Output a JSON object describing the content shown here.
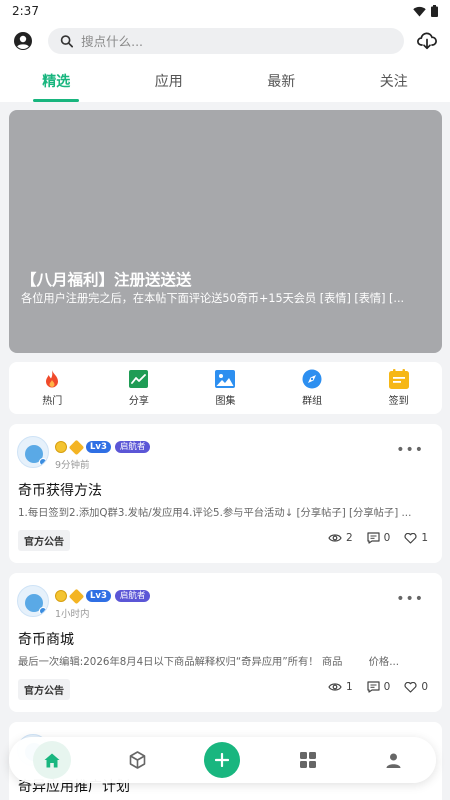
{
  "status": {
    "time": "2:37"
  },
  "search": {
    "placeholder": "搜点什么..."
  },
  "tabs": [
    {
      "label": "精选"
    },
    {
      "label": "应用"
    },
    {
      "label": "最新"
    },
    {
      "label": "关注"
    }
  ],
  "banner": {
    "title": "【八月福利】注册送送送",
    "desc": "各位用户注册完之后，在本帖下面评论送50奇币+15天会员 [表情] [表情] [..."
  },
  "quicknav": [
    {
      "label": "热门",
      "icon": "fire-icon"
    },
    {
      "label": "分享",
      "icon": "chart-icon"
    },
    {
      "label": "图集",
      "icon": "image-icon"
    },
    {
      "label": "群组",
      "icon": "compass-icon"
    },
    {
      "label": "签到",
      "icon": "checkin-icon"
    }
  ],
  "posts": [
    {
      "level": "Lv3",
      "role": "启航者",
      "time": "9分钟前",
      "title": "奇币获得方法",
      "excerpt": "1.每日签到2.添加Q群3.发帖/发应用4.评论5.参与平台活动↓ [分享帖子] [分享帖子] ...",
      "tag": "官方公告",
      "views": "2",
      "comments": "0",
      "likes": "1"
    },
    {
      "level": "Lv3",
      "role": "启航者",
      "time": "1小时内",
      "title": "奇币商城",
      "excerpt": "最后一次编辑:2026年8月4日以下商品解释权归“奇异应用”所有！ 商品        价格...",
      "tag": "官方公告",
      "views": "1",
      "comments": "0",
      "likes": "0"
    },
    {
      "title": "奇异应用推广计划"
    }
  ],
  "colors": {
    "accent": "#18b57e",
    "banner": "#a7a8ab"
  }
}
